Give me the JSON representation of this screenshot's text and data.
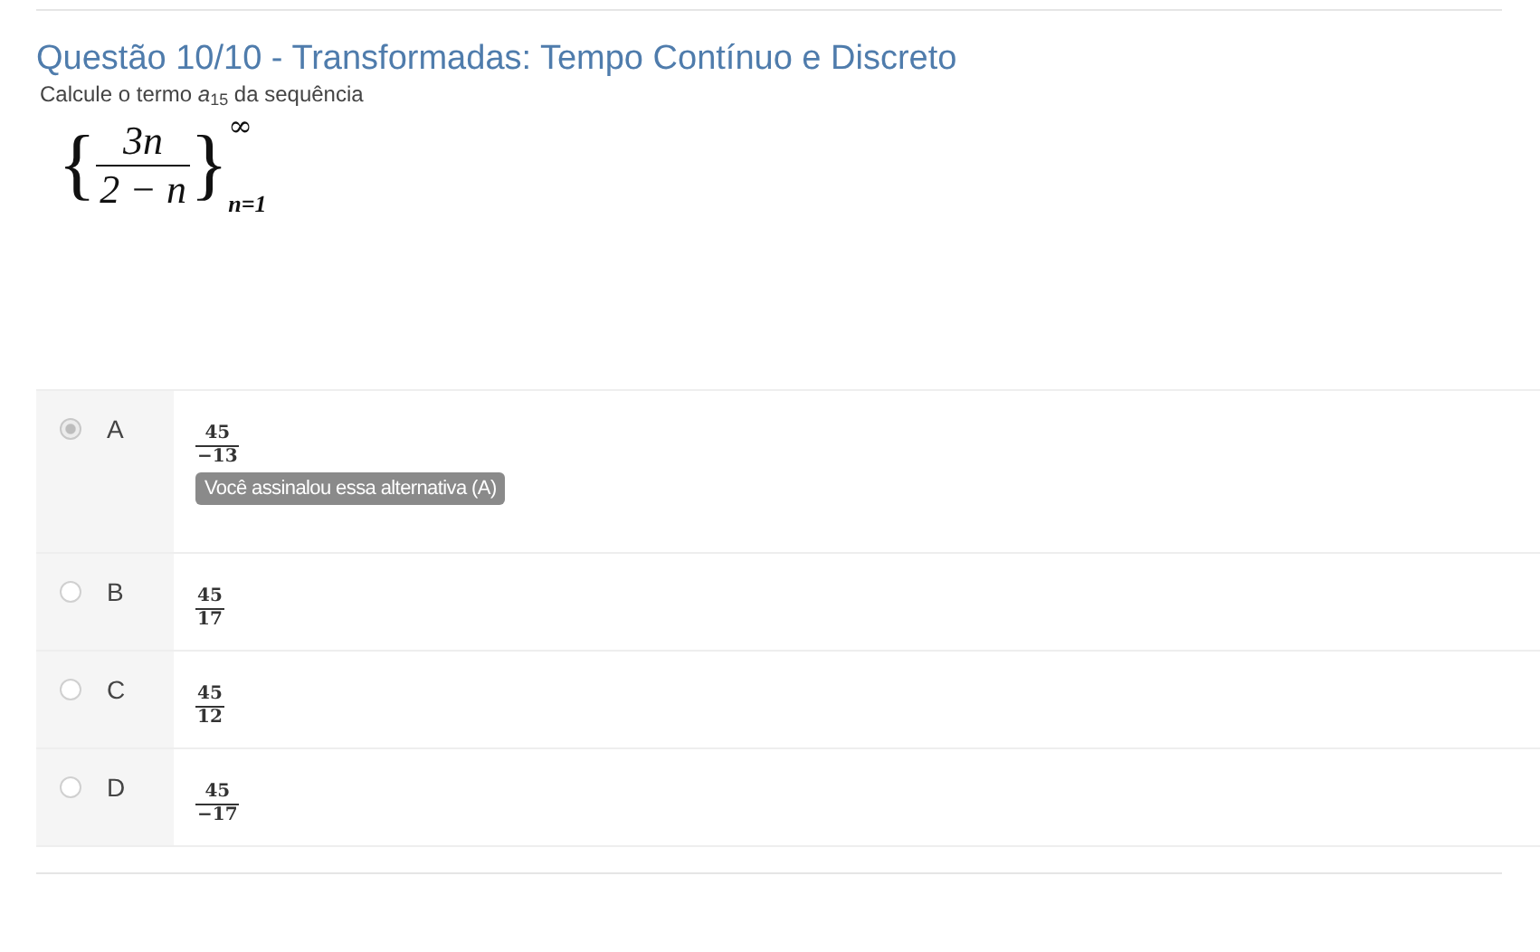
{
  "question": {
    "title": "Questão 10/10 - Transformadas: Tempo Contínuo e Discreto",
    "prompt": "Calcule o termo *a*$_{15}$ da sequência",
    "formula": {
      "open": "{",
      "numerator": "3n",
      "denominator": "2 − n",
      "close": "}",
      "upper": "∞",
      "lower": "n=1"
    }
  },
  "options": [
    {
      "letter": "A",
      "numerator": "45",
      "denominator": "−13",
      "selected": true,
      "feedback": "Você assinalou essa alternativa (A)"
    },
    {
      "letter": "B",
      "numerator": "45",
      "denominator": "17",
      "selected": false
    },
    {
      "letter": "C",
      "numerator": "45",
      "denominator": "12",
      "selected": false
    },
    {
      "letter": "D",
      "numerator": "45",
      "denominator": "−17",
      "selected": false
    }
  ]
}
